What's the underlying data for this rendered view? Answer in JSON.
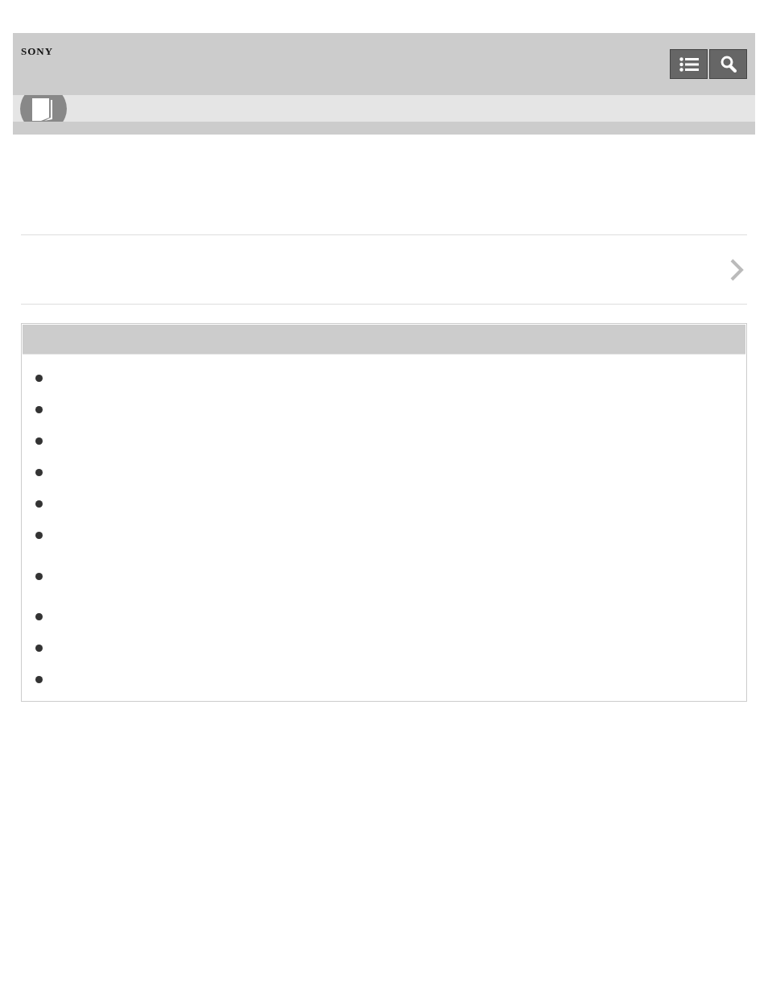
{
  "header": {
    "logo": "SONY",
    "buttons": [
      {
        "kind": "contents"
      },
      {
        "kind": "search"
      }
    ]
  },
  "link_row": {
    "kind": "next"
  },
  "related_box": {
    "items": [
      {
        "kind": "one-line"
      },
      {
        "kind": "one-line"
      },
      {
        "kind": "one-line"
      },
      {
        "kind": "one-line"
      },
      {
        "kind": "one-line"
      },
      {
        "kind": "one-line"
      },
      {
        "kind": "two-line"
      },
      {
        "kind": "one-line"
      },
      {
        "kind": "one-line"
      },
      {
        "kind": "one-line"
      }
    ]
  }
}
